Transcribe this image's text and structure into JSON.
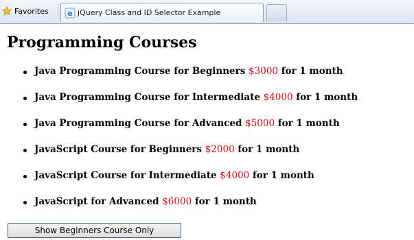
{
  "browser": {
    "favorites_label": "Favorites",
    "tab_title": "jQuery Class and ID Selector Example"
  },
  "page": {
    "heading": "Programming Courses",
    "courses": [
      {
        "name": "Java Programming Course for Beginners",
        "price": "$3000",
        "duration": "for 1 month"
      },
      {
        "name": "Java Programming Course for Intermediate",
        "price": "$4000",
        "duration": "for 1 month"
      },
      {
        "name": "Java Programming Course for Advanced",
        "price": "$5000",
        "duration": "for 1 month"
      },
      {
        "name": "JavaScript Course for Beginners",
        "price": "$2000",
        "duration": "for 1 month"
      },
      {
        "name": "JavaScript Course for Intermediate",
        "price": "$4000",
        "duration": "for 1 month"
      },
      {
        "name": "JavaScript for Advanced",
        "price": "$6000",
        "duration": "for 1 month"
      }
    ],
    "button_label": "Show Beginners Course Only"
  },
  "colors": {
    "price": "#cc1111",
    "button_border": "#3c5f8f"
  },
  "icons": {
    "favorites": "star-icon",
    "tab": "ie-page-icon"
  }
}
